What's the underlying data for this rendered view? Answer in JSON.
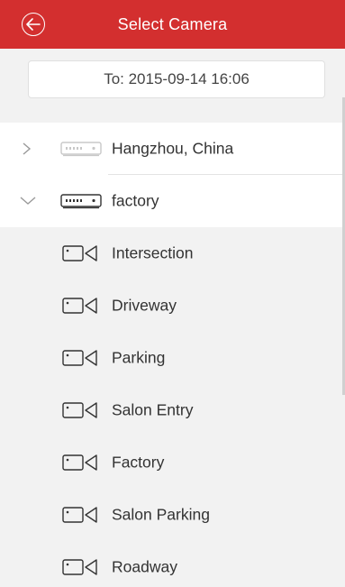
{
  "header": {
    "title": "Select Camera",
    "back_icon": "back-arrow-circle-icon"
  },
  "time_filter": {
    "text": "To:  2015-09-14  16:06"
  },
  "tree": {
    "devices": [
      {
        "name": "Hangzhou, China",
        "expanded": false,
        "icon": "dvr-icon"
      },
      {
        "name": "factory",
        "expanded": true,
        "icon": "dvr-icon"
      }
    ],
    "cameras": [
      "Intersection",
      "Driveway",
      "Parking",
      "Salon Entry",
      "Factory",
      "Salon Parking",
      "Roadway"
    ]
  },
  "colors": {
    "header_bg": "#d32f2f",
    "page_bg": "#f2f2f2"
  }
}
